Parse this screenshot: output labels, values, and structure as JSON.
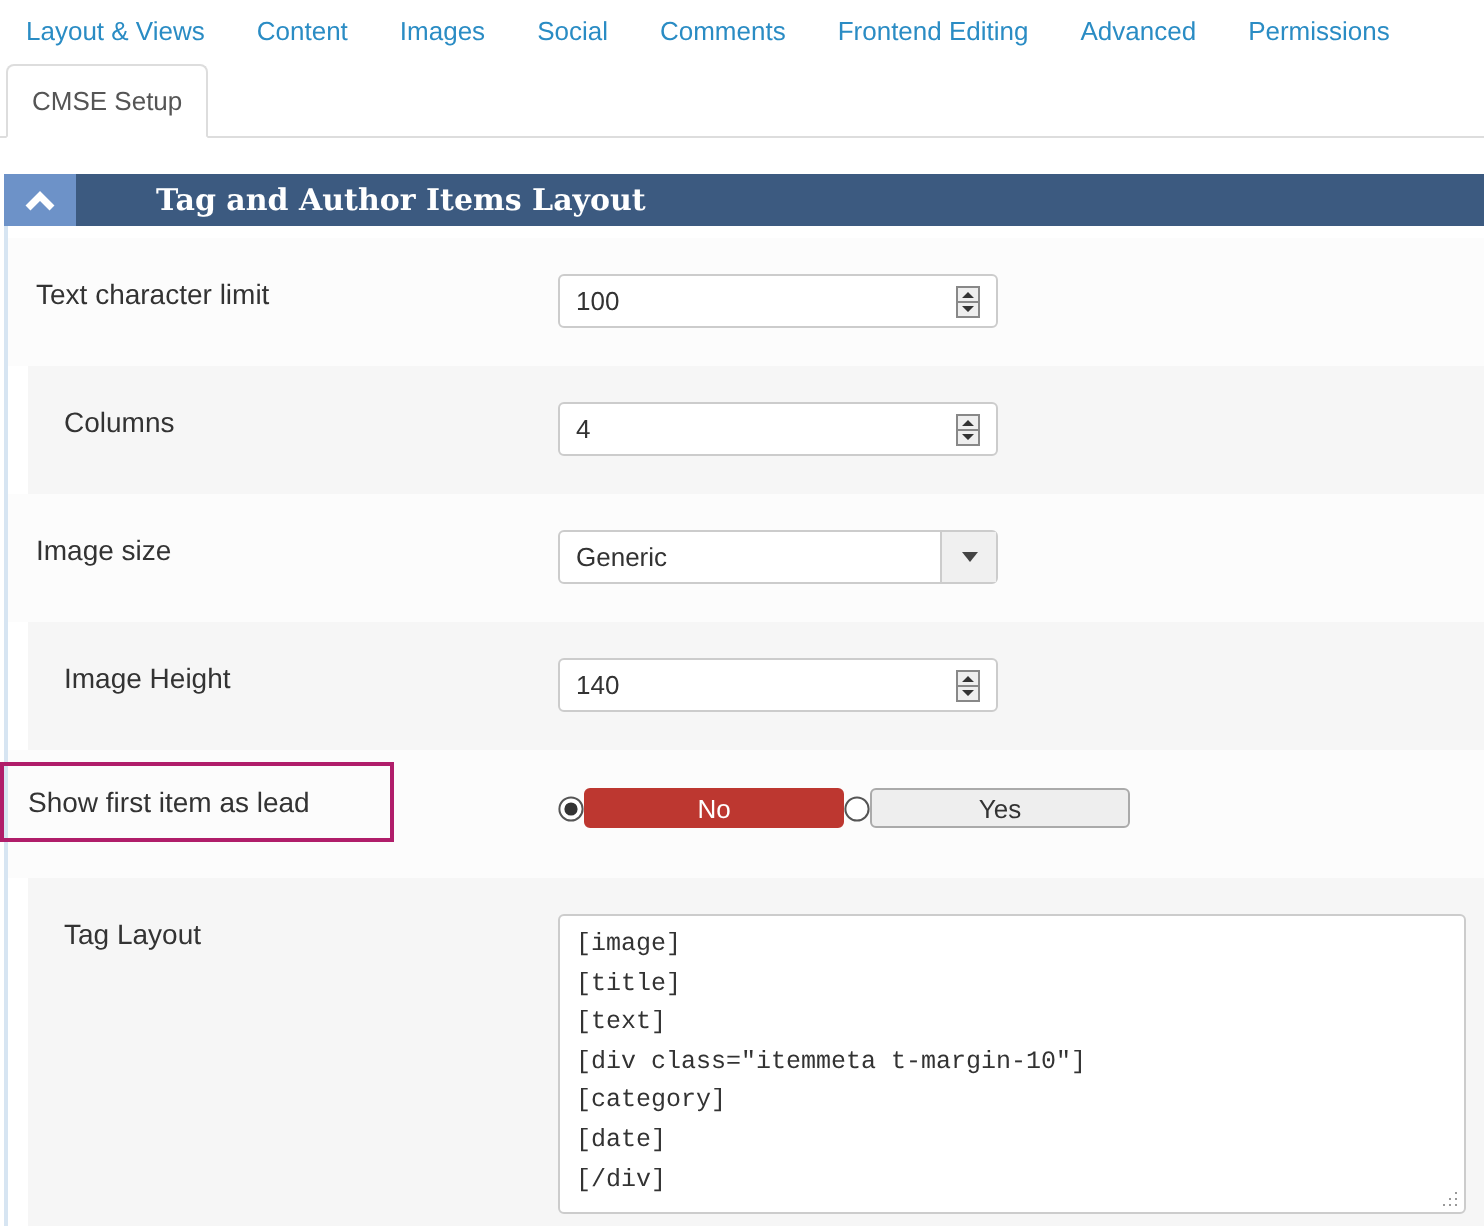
{
  "tabs": [
    {
      "label": "Layout & Views",
      "selected": false
    },
    {
      "label": "Content",
      "selected": false
    },
    {
      "label": "Images",
      "selected": false
    },
    {
      "label": "Social",
      "selected": false
    },
    {
      "label": "Comments",
      "selected": false
    },
    {
      "label": "Frontend Editing",
      "selected": false
    },
    {
      "label": "Advanced",
      "selected": false
    },
    {
      "label": "Permissions",
      "selected": false
    },
    {
      "label": "CMSE Setup",
      "selected": true
    }
  ],
  "panel": {
    "title": "Tag and Author Items Layout",
    "expanded": true,
    "fields": [
      {
        "kind": "number",
        "label": "Text character limit",
        "value": "100",
        "highlighted": false
      },
      {
        "kind": "number",
        "label": "Columns",
        "value": "4",
        "highlighted": false
      },
      {
        "kind": "select",
        "label": "Image size",
        "value": "Generic",
        "highlighted": false
      },
      {
        "kind": "number",
        "label": "Image Height",
        "value": "140",
        "highlighted": false
      },
      {
        "kind": "radio",
        "label": "Show first item as lead",
        "highlighted": true,
        "options": [
          {
            "label": "No",
            "selected": true
          },
          {
            "label": "Yes",
            "selected": false
          }
        ]
      },
      {
        "kind": "textarea",
        "label": "Tag Layout",
        "highlighted": false,
        "lines": [
          "[image]",
          "[title]",
          "[text]",
          "[div class=\"itemmeta t-margin-10\"]",
          "[category]",
          "[date]",
          "[/div]"
        ]
      }
    ]
  }
}
